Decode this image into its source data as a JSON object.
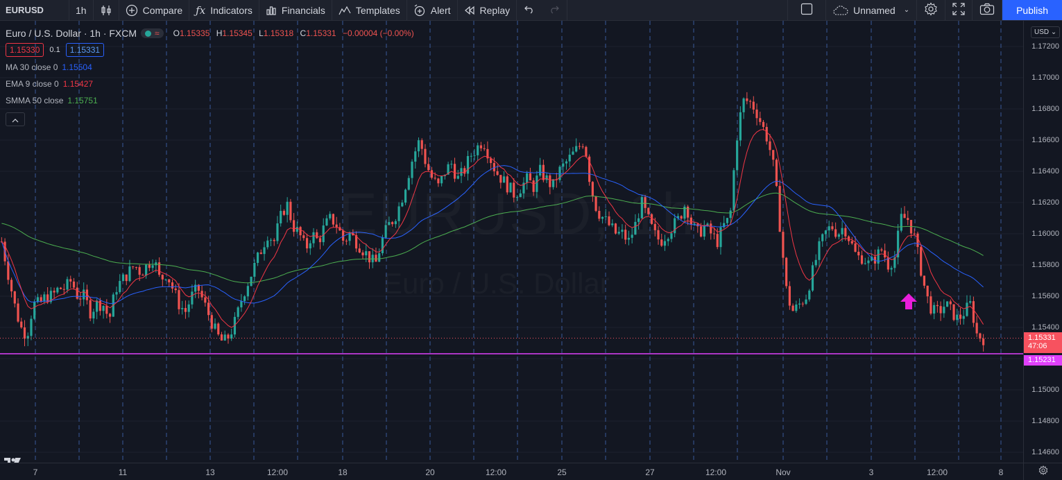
{
  "toolbar": {
    "symbol": "EURUSD",
    "interval": "1h",
    "compare": "Compare",
    "indicators": "Indicators",
    "financials": "Financials",
    "templates": "Templates",
    "alert": "Alert",
    "replay": "Replay",
    "layout_name": "Unnamed",
    "publish": "Publish"
  },
  "legend": {
    "title": "Euro / U.S. Dollar · 1h · FXCM",
    "open_label": "O",
    "open": "1.15335",
    "high_label": "H",
    "high": "1.15345",
    "low_label": "L",
    "low": "1.15318",
    "close_label": "C",
    "close": "1.15331",
    "change": "−0.00004 (−0.00%)",
    "sell_price": "1.15330",
    "spread": "0.1",
    "buy_price": "1.15331"
  },
  "indicators": [
    {
      "label": "MA 30 close 0",
      "value": "1.15504",
      "color": "#2962ff"
    },
    {
      "label": "EMA 9 close 0",
      "value": "1.15427",
      "color": "#f23645"
    },
    {
      "label": "SMMA 50 close",
      "value": "1.15751",
      "color": "#4caf50"
    }
  ],
  "watermark": {
    "symbol": "EURUSD, 1h",
    "description": "Euro / U.S. Dollar"
  },
  "price_axis": {
    "currency": "USD",
    "ticks": [
      "1.17200",
      "1.17000",
      "1.16800",
      "1.16600",
      "1.16400",
      "1.16200",
      "1.16000",
      "1.15800",
      "1.15600",
      "1.15400",
      "1.15200",
      "1.15000",
      "1.14800",
      "1.14600"
    ],
    "last_price": "1.15331",
    "countdown": "47:06",
    "horizontal_line_price": "1.15231",
    "colors": {
      "last": "#f7525f",
      "hline": "#e040fb"
    }
  },
  "time_axis": {
    "ticks": [
      "7",
      "11",
      "13",
      "12:00",
      "18",
      "20",
      "12:00",
      "25",
      "27",
      "12:00",
      "Nov",
      "3",
      "12:00",
      "8"
    ]
  },
  "chart_data": {
    "type": "candlestick",
    "price_range": [
      1.1455,
      1.173
    ],
    "close_path": [
      1.1595,
      1.1575,
      1.1555,
      1.154,
      1.1535,
      1.1555,
      1.1555,
      1.156,
      1.156,
      1.1565,
      1.1565,
      1.157,
      1.156,
      1.156,
      1.155,
      1.1555,
      1.1555,
      1.1545,
      1.1565,
      1.157,
      1.1575,
      1.158,
      1.1575,
      1.158,
      1.1585,
      1.157,
      1.1575,
      1.1565,
      1.1555,
      1.155,
      1.156,
      1.1565,
      1.1555,
      1.1545,
      1.1535,
      1.153,
      1.1535,
      1.1545,
      1.156,
      1.157,
      1.158,
      1.159,
      1.16,
      1.1595,
      1.161,
      1.162,
      1.1605,
      1.16,
      1.159,
      1.16,
      1.1595,
      1.1605,
      1.161,
      1.1605,
      1.1595,
      1.16,
      1.1595,
      1.159,
      1.1585,
      1.158,
      1.1595,
      1.1605,
      1.161,
      1.162,
      1.1635,
      1.165,
      1.166,
      1.1645,
      1.1635,
      1.163,
      1.164,
      1.1645,
      1.1635,
      1.164,
      1.165,
      1.1655,
      1.166,
      1.165,
      1.164,
      1.1635,
      1.163,
      1.1625,
      1.163,
      1.1635,
      1.163,
      1.164,
      1.1635,
      1.163,
      1.164,
      1.1645,
      1.165,
      1.1655,
      1.166,
      1.163,
      1.1615,
      1.161,
      1.1605,
      1.16,
      1.16,
      1.1595,
      1.1605,
      1.162,
      1.161,
      1.16,
      1.1595,
      1.16,
      1.1605,
      1.161,
      1.162,
      1.1605,
      1.16,
      1.1605,
      1.16,
      1.1595,
      1.1605,
      1.161,
      1.166,
      1.1685,
      1.1685,
      1.168,
      1.167,
      1.166,
      1.164,
      1.16,
      1.156,
      1.155,
      1.1555,
      1.156,
      1.1575,
      1.159,
      1.16,
      1.1605,
      1.16,
      1.1605,
      1.1595,
      1.1585,
      1.1585,
      1.158,
      1.1585,
      1.159,
      1.158,
      1.1585,
      1.161,
      1.161,
      1.16,
      1.158,
      1.156,
      1.155,
      1.155,
      1.1555,
      1.155,
      1.1545,
      1.155,
      1.1555,
      1.1535,
      1.1533
    ],
    "series": [
      {
        "name": "MA 30 close 0",
        "color": "#2962ff"
      },
      {
        "name": "EMA 9 close 0",
        "color": "#f23645"
      },
      {
        "name": "SMMA 50 close",
        "color": "#4caf50"
      }
    ],
    "horizontal_line": 1.15231,
    "last_price": 1.15331
  }
}
